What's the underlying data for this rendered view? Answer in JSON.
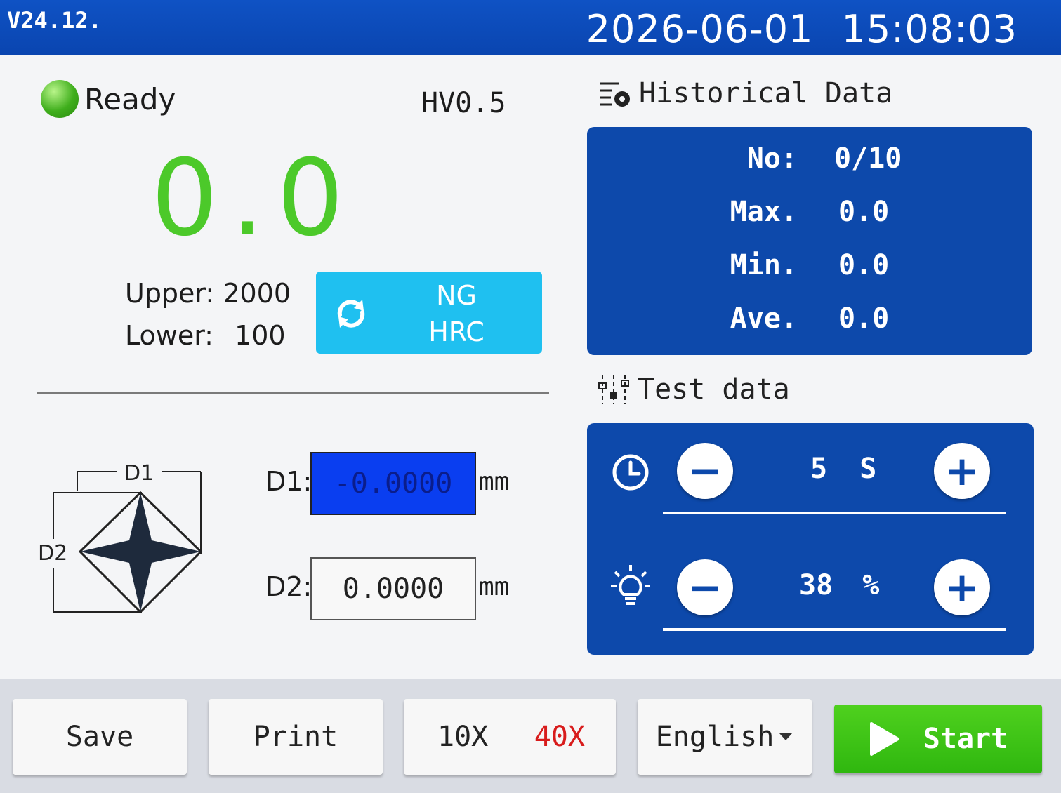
{
  "header": {
    "version": "V24.12.",
    "date": "2026-06-01",
    "time": "15:08:03"
  },
  "status": {
    "label": "Ready",
    "led_color": "#3fae1c",
    "mode": "HV0.5"
  },
  "measurement": {
    "value": "0.0",
    "value_color": "#4cc92a"
  },
  "limits": {
    "upper_label": "Upper:",
    "upper_value": "2000",
    "lower_label": "Lower:",
    "lower_value": "100"
  },
  "ng_button": {
    "line1": "NG",
    "line2": "HRC",
    "icon": "refresh-icon",
    "color": "#1fc0f0"
  },
  "indenter_diagram": {
    "d1_label": "D1",
    "d2_label": "D2"
  },
  "diagonals": {
    "d1_label": "D1:",
    "d1_value": "-0.0000",
    "d2_label": "D2:",
    "d2_value": "0.0000",
    "unit": "mm"
  },
  "historical": {
    "title": "Historical Data",
    "rows": [
      {
        "label": "No:",
        "value": "0/10"
      },
      {
        "label": "Max.",
        "value": "0.0"
      },
      {
        "label": "Min.",
        "value": "0.0"
      },
      {
        "label": "Ave.",
        "value": "0.0"
      }
    ]
  },
  "test_data": {
    "title": "Test data",
    "dwell": {
      "value": "5",
      "unit": "S",
      "icon": "clock-icon"
    },
    "light": {
      "value": "38",
      "unit": "%",
      "icon": "bulb-icon"
    },
    "minus_label": "−",
    "plus_label": "+"
  },
  "toolbar": {
    "save": "Save",
    "print": "Print",
    "mag_10x": "10X",
    "mag_40x": "40X",
    "language": "English",
    "start": "Start"
  },
  "colors": {
    "header_blue": "#0f52c4",
    "panel_blue": "#0d49ab",
    "start_green": "#3fc315",
    "mag_active": "#d81c1c"
  }
}
